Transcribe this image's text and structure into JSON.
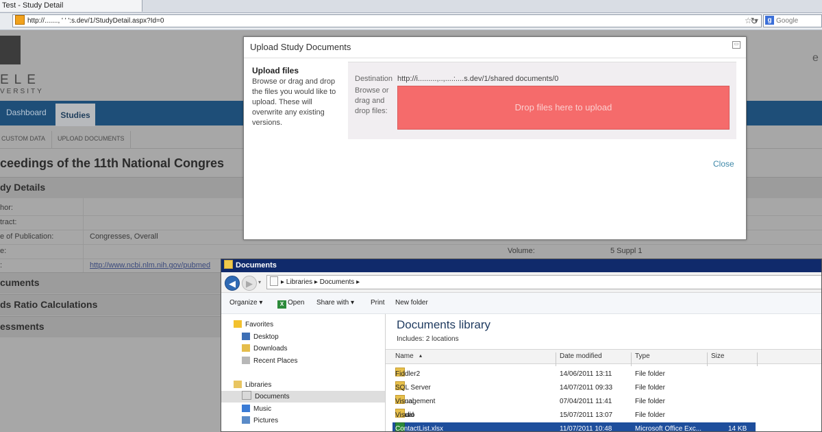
{
  "browser": {
    "tab_title": "Test - Study Detail",
    "url": "http://.......,  '  '     ':s.dev/1/StudyDetail.aspx?Id=0",
    "search_placeholder": "Google",
    "url_icons": "☆ ▾"
  },
  "page": {
    "logo_text": "ELE",
    "logo_sub": "VERSITY",
    "right_text": "e",
    "nav": {
      "dashboard": "Dashboard",
      "studies": "Studies"
    },
    "subnav": {
      "custom_data": "CUSTOM DATA",
      "upload_documents": "UPLOAD DOCUMENTS"
    },
    "title": "ceedings of the 11th National Congres",
    "study_details_heading": "dy Details",
    "fields": {
      "author": "hor:",
      "abstract": "tract:",
      "publication_label": "e of Publication:",
      "publication_value": "Congresses, Overall",
      "type_label": "e:",
      "volume_label": "Volume:",
      "volume_value": "5 Suppl 1",
      "link_label": ":",
      "link_value": "http://www.ncbi.nlm.nih.gov/pubmed"
    },
    "sections": {
      "documents": "cuments",
      "odds": "ds Ratio Calculations",
      "assessments": "essments"
    }
  },
  "modal": {
    "title": "Upload Study Documents",
    "heading": "Upload files",
    "description": "Browse or drag and drop the files you would like to upload. These will overwrite any existing versions.",
    "destination_label": "Destination",
    "destination_value": "http://i.........,..,....:....s.dev/1/shared documents/0",
    "browse_label": "Browse or drag and drop files:",
    "dropzone_text": "Drop files here to upload",
    "close": "Close",
    "close_icon": "▭"
  },
  "explorer": {
    "title": "Documents",
    "breadcrumb": "▸ Libraries ▸ Documents ▸",
    "toolbar": {
      "organize": "Organize ▾",
      "open": "Open",
      "share": "Share with ▾",
      "print": "Print",
      "new_folder": "New folder"
    },
    "nav": {
      "favorites": "Favorites",
      "desktop": "Desktop",
      "downloads": "Downloads",
      "recent": "Recent Places",
      "libraries": "Libraries",
      "documents": "Documents",
      "music": "Music",
      "pictures": "Pictures"
    },
    "library_title": "Documents library",
    "library_sub": "Includes:  2 locations",
    "columns": {
      "name": "Name",
      "date": "Date modified",
      "type": "Type",
      "size": "Size"
    },
    "files": [
      {
        "name": "Fiddler2",
        "date": "14/06/2011 13:11",
        "type": "File folder",
        "size": ""
      },
      {
        "name": "SQL Server Management Studio",
        "date": "14/07/2011 09:33",
        "type": "File folder",
        "size": ""
      },
      {
        "name": "Visual Studio 2005",
        "date": "07/04/2011 11:41",
        "type": "File folder",
        "size": ""
      },
      {
        "name": "Visual Studio 2010",
        "date": "15/07/2011 13:07",
        "type": "File folder",
        "size": ""
      },
      {
        "name": "ContactList.xlsx",
        "date": "11/07/2011 10:48",
        "type": "Microsoft Office Exc...",
        "size": "14 KB"
      }
    ]
  }
}
